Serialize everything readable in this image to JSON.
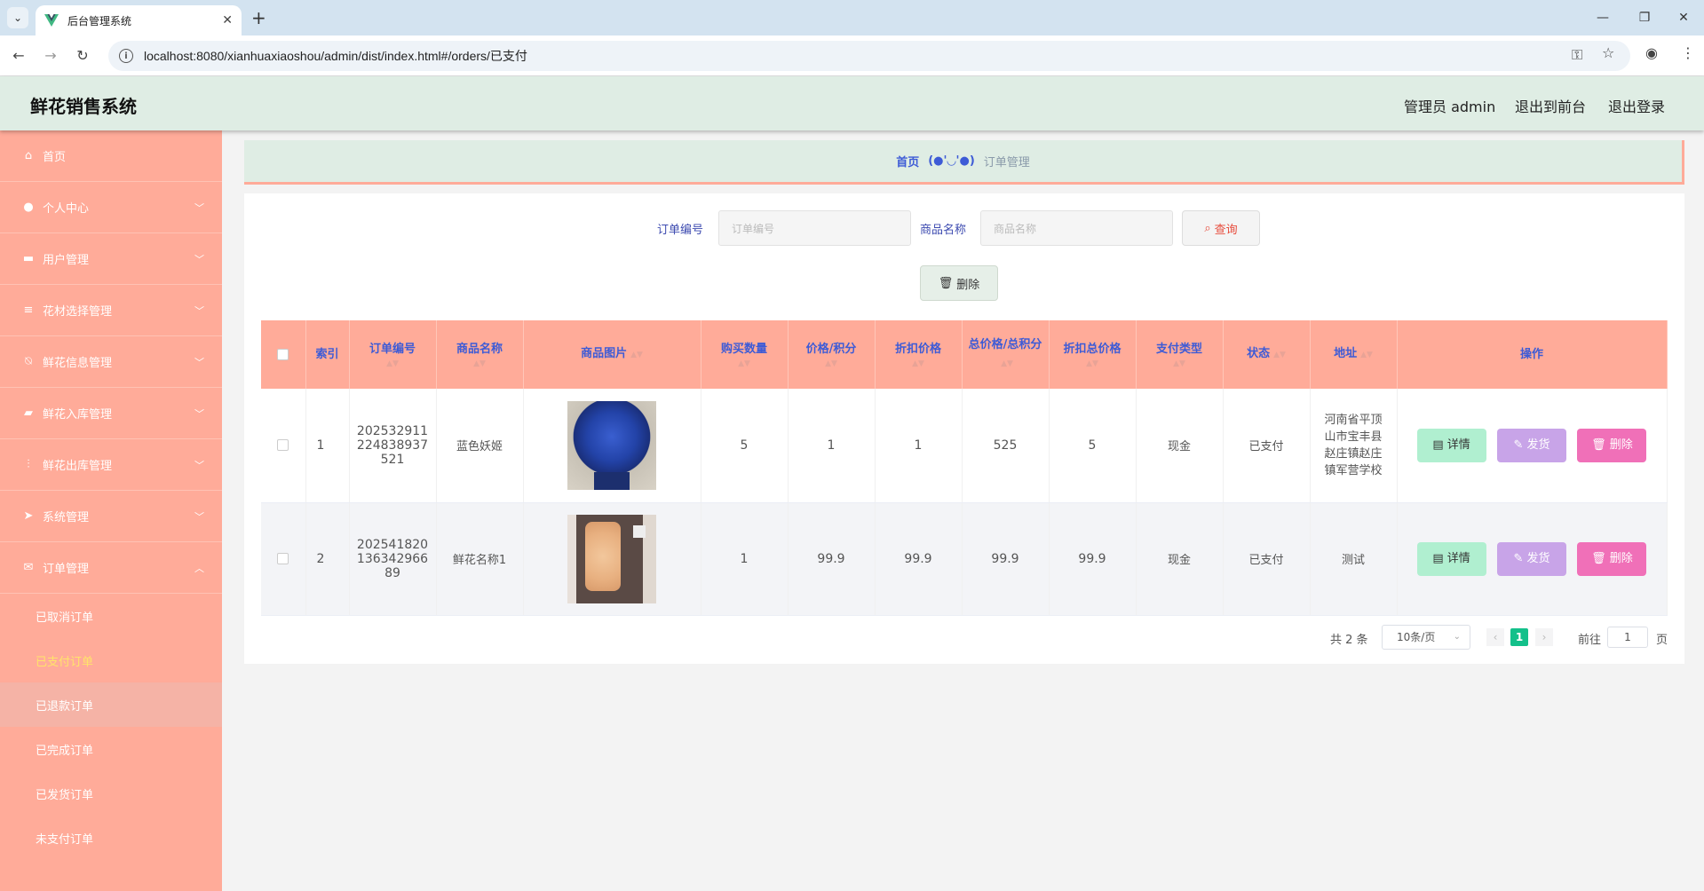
{
  "browser": {
    "tab_title": "后台管理系统",
    "url": "localhost:8080/xianhuaxiaoshou/admin/dist/index.html#/orders/已支付"
  },
  "header": {
    "title": "鲜花销售系统",
    "admin_label": "管理员 admin",
    "front_link": "退出到前台",
    "logout_link": "退出登录"
  },
  "sidebar": {
    "items": [
      {
        "label": "首页",
        "icon": "home-icon"
      },
      {
        "label": "个人中心",
        "icon": "user-icon"
      },
      {
        "label": "用户管理",
        "icon": "chat-icon"
      },
      {
        "label": "花材选择管理",
        "icon": "list-icon"
      },
      {
        "label": "鲜花信息管理",
        "icon": "bell-off-icon"
      },
      {
        "label": "鲜花入库管理",
        "icon": "box-icon"
      },
      {
        "label": "鲜花出库管理",
        "icon": "sliders-icon"
      },
      {
        "label": "系统管理",
        "icon": "send-icon"
      },
      {
        "label": "订单管理",
        "icon": "mail-icon"
      }
    ],
    "sub_items": [
      {
        "label": "已取消订单"
      },
      {
        "label": "已支付订单"
      },
      {
        "label": "已退款订单"
      },
      {
        "label": "已完成订单"
      },
      {
        "label": "已发货订单"
      },
      {
        "label": "未支付订单"
      }
    ]
  },
  "breadcrumb": {
    "home": "首页",
    "sep": "(●'◡'●)",
    "current": "订单管理"
  },
  "search": {
    "order_no_label": "订单编号",
    "order_no_placeholder": "订单编号",
    "product_label": "商品名称",
    "product_placeholder": "商品名称",
    "query_button": "查询",
    "delete_button": "删除"
  },
  "table": {
    "headers": [
      "索引",
      "订单编号",
      "商品名称",
      "商品图片",
      "购买数量",
      "价格/积分",
      "折扣价格",
      "总价格/总积分",
      "折扣总价格",
      "支付类型",
      "状态",
      "地址",
      "操作"
    ],
    "rows": [
      {
        "index": "1",
        "order_no": "202532911224838937521",
        "order_no_lines": [
          "202532911",
          "224838937",
          "521"
        ],
        "product": "蓝色妖姬",
        "image": "blue-rose-bouquet",
        "qty": "5",
        "price": "1",
        "discount_price": "1",
        "total": "525",
        "discount_total": "5",
        "pay_type": "现金",
        "status": "已支付",
        "address_lines": [
          "河南省平顶",
          "山市宝丰县",
          "赵庄镇赵庄",
          "镇军营学校"
        ]
      },
      {
        "index": "2",
        "order_no": "20254182013634296689",
        "order_no_lines": [
          "202541820",
          "136342966",
          "89"
        ],
        "product": "鲜花名称1",
        "image": "peach-rose-box",
        "qty": "1",
        "price": "99.9",
        "discount_price": "99.9",
        "total": "99.9",
        "discount_total": "99.9",
        "pay_type": "现金",
        "status": "已支付",
        "address_lines": [
          "测试"
        ]
      }
    ],
    "actions": {
      "detail": "详情",
      "ship": "发货",
      "delete": "删除"
    }
  },
  "pagination": {
    "total_text": "共 2 条",
    "page_size": "10条/页",
    "current_page": "1",
    "goto_label": "前往",
    "goto_value": "1",
    "page_suffix": "页"
  },
  "colors": {
    "sidebar_bg": "#ffab99",
    "header_bg": "#dfede4",
    "accent_blue": "#3d5bd6",
    "active_sub": "#ffe46a",
    "page_active": "#13c08a"
  }
}
